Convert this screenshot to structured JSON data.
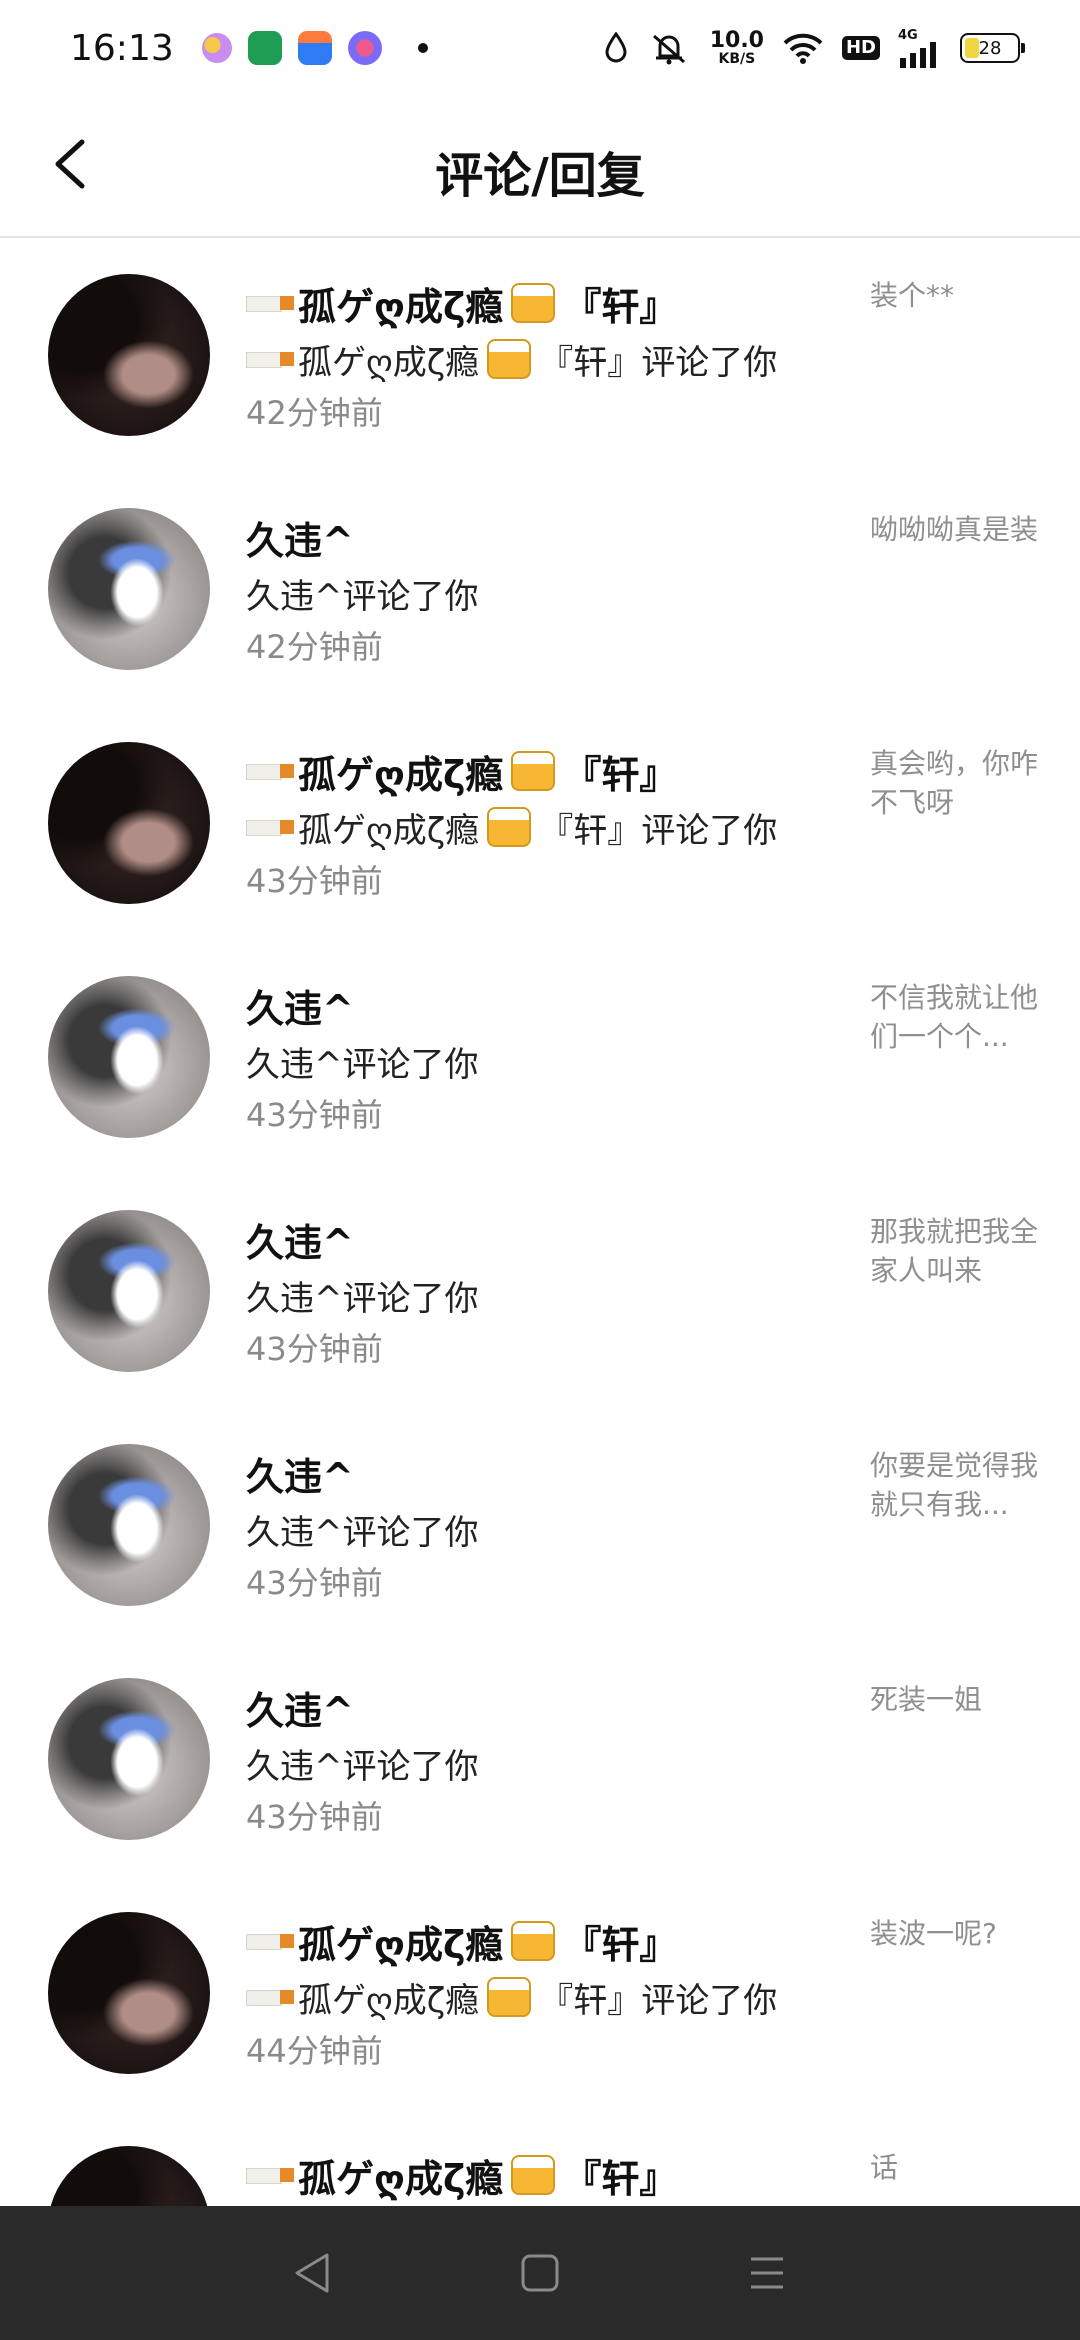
{
  "status_bar": {
    "time": "16:13",
    "net_speed_value": "10.0",
    "net_speed_unit": "KB/S",
    "hd": "HD",
    "network": "4G",
    "battery_level": "28"
  },
  "header": {
    "title": "评论/回复"
  },
  "notifications": [
    {
      "name": "孤ゲღ成ζ瘾",
      "suffix": "『轩』",
      "action": "评论了你",
      "time": "42分钟前",
      "preview": "装个**",
      "avatar": "dark",
      "decorated": true
    },
    {
      "name": "久违^",
      "suffix": "",
      "action": "评论了你",
      "time": "42分钟前",
      "preview": "呦呦呦真是装",
      "avatar": "light",
      "decorated": false
    },
    {
      "name": "孤ゲღ成ζ瘾",
      "suffix": "『轩』",
      "action": "评论了你",
      "time": "43分钟前",
      "preview": "真会哟，你咋不飞呀",
      "avatar": "dark",
      "decorated": true
    },
    {
      "name": "久违^",
      "suffix": "",
      "action": "评论了你",
      "time": "43分钟前",
      "preview": "不信我就让他们一个个...",
      "avatar": "light",
      "decorated": false
    },
    {
      "name": "久违^",
      "suffix": "",
      "action": "评论了你",
      "time": "43分钟前",
      "preview": "那我就把我全家人叫来",
      "avatar": "light",
      "decorated": false
    },
    {
      "name": "久违^",
      "suffix": "",
      "action": "评论了你",
      "time": "43分钟前",
      "preview": "你要是觉得我就只有我...",
      "avatar": "light",
      "decorated": false
    },
    {
      "name": "久违^",
      "suffix": "",
      "action": "评论了你",
      "time": "43分钟前",
      "preview": "死装一姐",
      "avatar": "light",
      "decorated": false
    },
    {
      "name": "孤ゲღ成ζ瘾",
      "suffix": "『轩』",
      "action": "评论了你",
      "time": "44分钟前",
      "preview": "装波一呢?",
      "avatar": "dark",
      "decorated": true
    },
    {
      "name": "孤ゲღ成ζ瘾",
      "suffix": "『轩』",
      "action": "",
      "time": "",
      "preview": "话",
      "avatar": "dark",
      "decorated": true
    }
  ],
  "icons": {
    "back": "back-arrow-icon",
    "nav_back": "nav-back-icon",
    "nav_home": "nav-home-icon",
    "nav_menu": "nav-menu-icon"
  }
}
